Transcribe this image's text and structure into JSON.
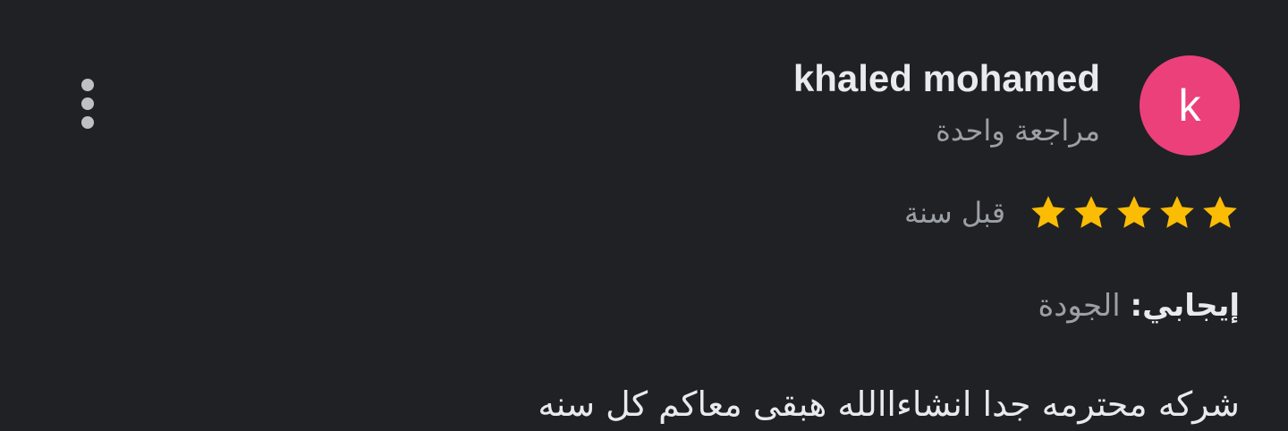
{
  "review": {
    "avatar_letter": "k",
    "avatar_color": "#ec407a",
    "reviewer_name": "khaled mohamed",
    "review_count_text": "مراجعة واحدة",
    "rating": 5,
    "rating_max": 5,
    "star_color": "#fbbc04",
    "date_text": "قبل سنة",
    "positive_label": "إيجابي:",
    "positive_value": "الجودة",
    "text": "شركه محترمه جدا انشاءاالله هبقى معاكم كل سنه"
  },
  "menu": {
    "icon": "more-vert-icon"
  }
}
